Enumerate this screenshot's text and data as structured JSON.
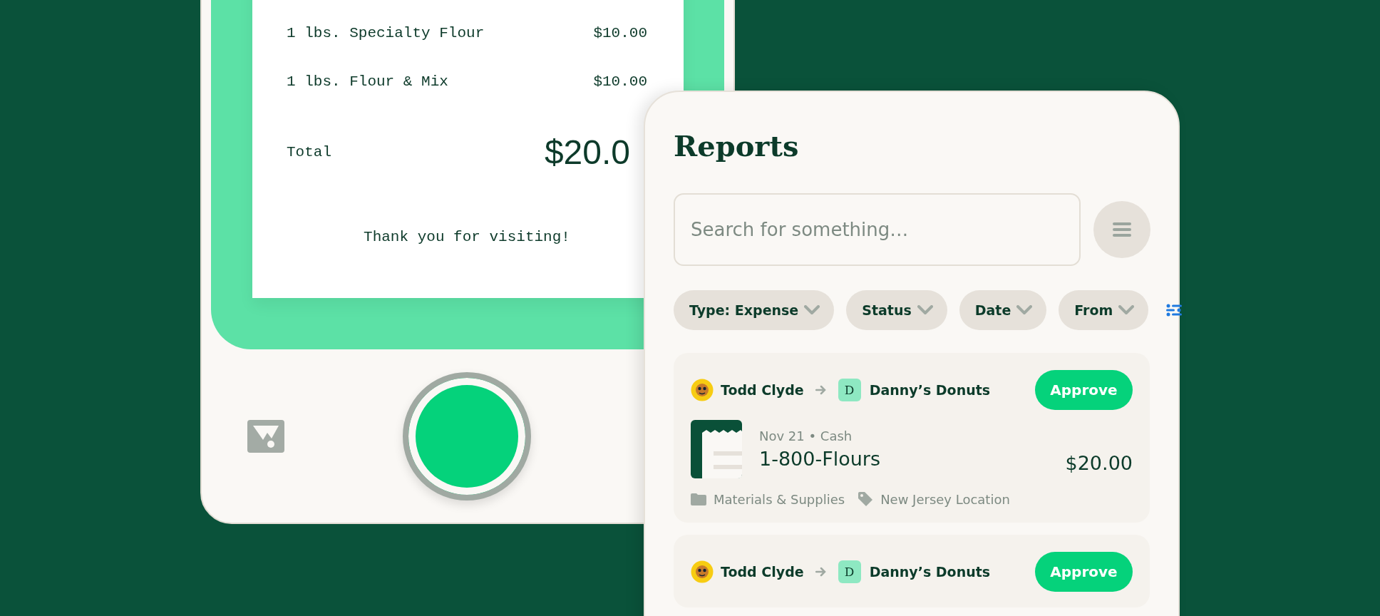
{
  "receipt": {
    "items": [
      {
        "name": "1 lbs. Specialty Flour",
        "price": "$10.00"
      },
      {
        "name": "1 lbs. Flour & Mix",
        "price": "$10.00"
      }
    ],
    "total_label": "Total",
    "total": "$20.0",
    "message": "Thank you for visiting!"
  },
  "reports": {
    "title": "Reports",
    "search": {
      "placeholder": "Search for something…"
    },
    "filters": [
      {
        "label": "Type: Expense"
      },
      {
        "label": "Status"
      },
      {
        "label": "Date"
      },
      {
        "label": "From"
      }
    ],
    "cards": [
      {
        "from": "Todd Clyde",
        "to_initial": "D",
        "to": "Danny’s Donuts",
        "action": "Approve",
        "date_method": "Nov 21 • Cash",
        "merchant": "1-800-Flours",
        "amount": "$20.00",
        "category": "Materials & Supplies",
        "tag": "New Jersey Location"
      },
      {
        "from": "Todd Clyde",
        "to_initial": "D",
        "to": "Danny’s Donuts",
        "action": "Approve"
      }
    ]
  }
}
